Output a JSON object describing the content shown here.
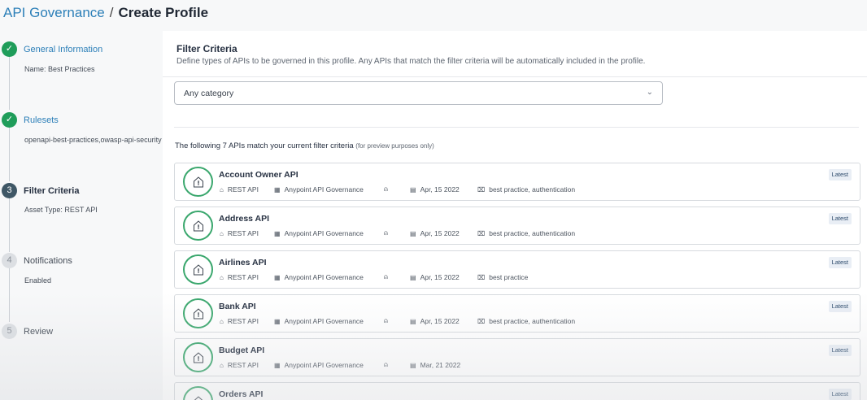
{
  "header": {
    "breadcrumb_link": "API Governance",
    "separator": "/",
    "current": "Create Profile"
  },
  "steps": [
    {
      "number": "✓",
      "title": "General Information",
      "subtitle": "Name: Best Practices",
      "state": "done"
    },
    {
      "number": "✓",
      "title": "Rulesets",
      "subtitle": "openapi-best-practices,owasp-api-security",
      "state": "done"
    },
    {
      "number": "3",
      "title": "Filter Criteria",
      "subtitle": "Asset Type: REST API",
      "state": "active"
    },
    {
      "number": "4",
      "title": "Notifications",
      "subtitle": "Enabled",
      "state": "todo"
    },
    {
      "number": "5",
      "title": "Review",
      "subtitle": "",
      "state": "todo"
    }
  ],
  "main": {
    "title": "Filter Criteria",
    "description": "Define types of APIs to be governed in this profile. Any APIs that match the filter criteria will be automatically included in the profile.",
    "category_dropdown": {
      "value": "Any category",
      "chevron": "⌄"
    },
    "match_text": "The following 7 APIs match your current filter criteria",
    "match_note": "(for preview purposes only)"
  },
  "apis": [
    {
      "name": "Account Owner API",
      "type": "REST API",
      "org": "Anypoint API Governance",
      "date": "Apr, 15 2022",
      "tags": "best practice, authentication",
      "badge": "Latest"
    },
    {
      "name": "Address API",
      "type": "REST API",
      "org": "Anypoint API Governance",
      "date": "Apr, 15 2022",
      "tags": "best practice, authentication",
      "badge": "Latest"
    },
    {
      "name": "Airlines API",
      "type": "REST API",
      "org": "Anypoint API Governance",
      "date": "Apr, 15 2022",
      "tags": "best practice",
      "badge": "Latest"
    },
    {
      "name": "Bank API",
      "type": "REST API",
      "org": "Anypoint API Governance",
      "date": "Apr, 15 2022",
      "tags": "best practice, authentication",
      "badge": "Latest"
    },
    {
      "name": "Budget API",
      "type": "REST API",
      "org": "Anypoint API Governance",
      "date": "Mar, 21 2022",
      "tags": "",
      "badge": "Latest"
    },
    {
      "name": "Orders API",
      "type": "",
      "org": "",
      "date": "",
      "tags": "",
      "badge": "Latest"
    }
  ],
  "colors": {
    "accent": "#2c7fb8",
    "success": "#1f9d5a",
    "active_step": "#3f5766",
    "api_ring": "#3aa76d"
  }
}
